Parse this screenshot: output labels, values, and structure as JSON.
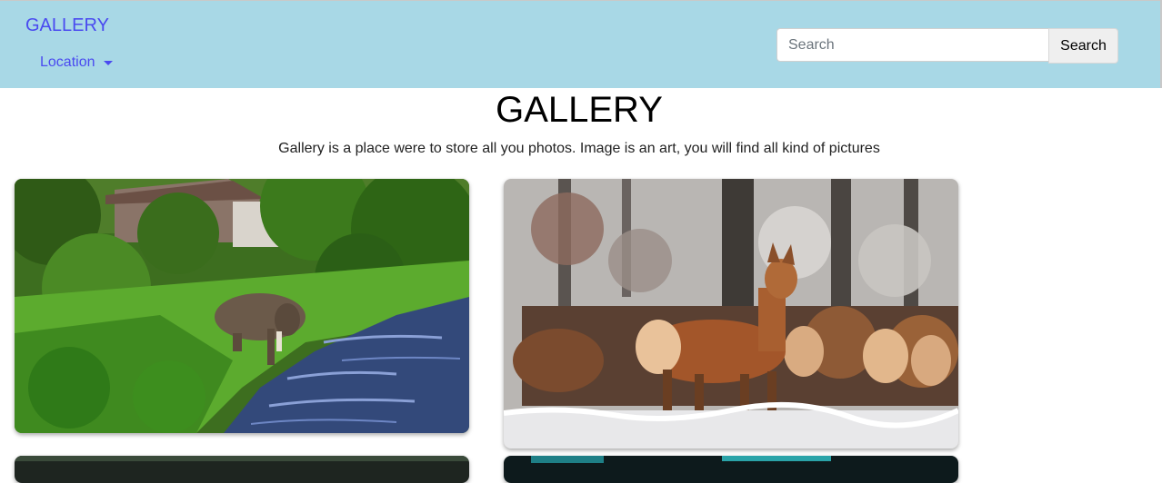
{
  "navbar": {
    "brand": "GALLERY",
    "dropdown_label": "Location",
    "search": {
      "placeholder": "Search",
      "button_label": "Search"
    }
  },
  "main": {
    "title": "GALLERY",
    "description": "Gallery is a place were to store all you photos. Image is an art, you will find all kind of pictures"
  },
  "gallery": {
    "images": [
      {
        "subject": "elephant by a river in a forest"
      },
      {
        "subject": "herd of deer in a snowy forest"
      },
      {
        "subject": "dark photo (partially visible)"
      },
      {
        "subject": "dark teal photo (partially visible)"
      }
    ]
  },
  "colors": {
    "navbar_bg": "#a8d8e6",
    "link": "#4a4af0"
  }
}
